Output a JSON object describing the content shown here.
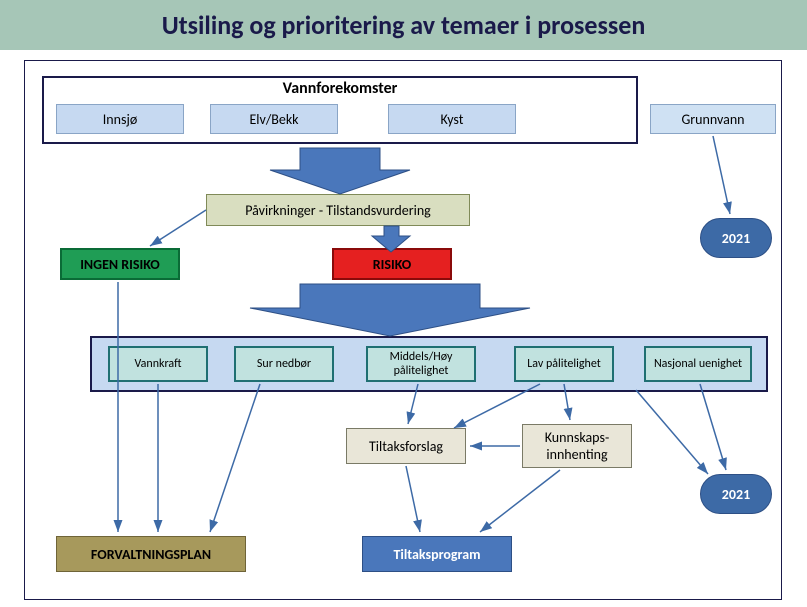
{
  "title": "Utsiling og prioritering av temaer i prosessen",
  "top": {
    "header": "Vannforekomster",
    "items": [
      "Innsjø",
      "Elv/Bekk",
      "Kyst",
      "Grunnvann"
    ]
  },
  "assessment": "Påvirkninger - Tilstandsvurdering",
  "risk": {
    "none": "INGEN RISIKO",
    "yes": "RISIKO"
  },
  "row": {
    "vannkraft": "Vannkraft",
    "sur": "Sur nedbør",
    "mid": "Middels/Høy pålitelighet",
    "lav": "Lav pålitelighet",
    "nasj": "Nasjonal uenighet"
  },
  "tiltaksforslag": "Tiltaksforslag",
  "kunnskap": "Kunnskaps-\ninnhenting",
  "forvaltningsplan": "FORVALTNINGSPLAN",
  "tiltaksprogram": "Tiltaksprogram",
  "year": "2021",
  "colors": {
    "accent": "#4a77bb",
    "green": "#1f9d55",
    "red": "#e52020",
    "lightblue": "#c6d9f1",
    "tealbox": "#c1e2df",
    "khaki": "#d9dec0",
    "olive": "#a7995c",
    "pill": "#3d6aa6"
  }
}
